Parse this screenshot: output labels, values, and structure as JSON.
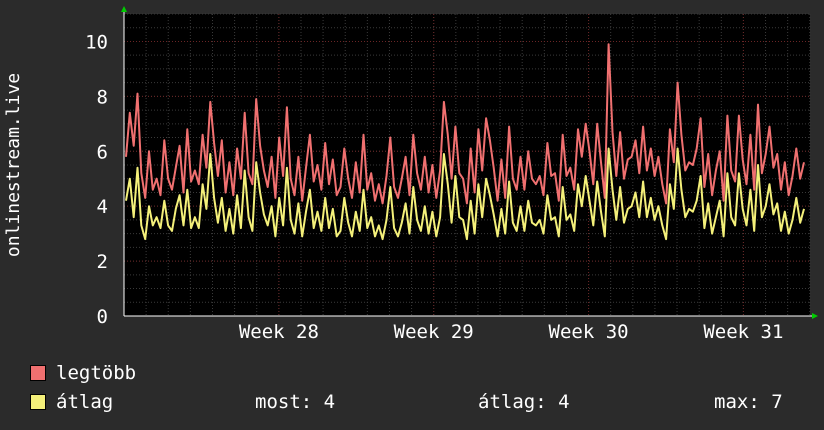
{
  "colors": {
    "background": "#2b2b2b",
    "plot_background": "#000000",
    "grid_minor": "#3a3a3a",
    "grid_major": "#6a2525",
    "axis_arrow": "#00cc00",
    "text": "#ffffff"
  },
  "legend": [
    {
      "label": "legtöbb",
      "color": "#f07070"
    },
    {
      "label": "átlag",
      "color": "#f4f07a"
    }
  ],
  "stats": {
    "most": "most: 4",
    "atlag": "átlag: 4",
    "max": "max: 7"
  },
  "chart_data": {
    "type": "line",
    "ylabel": "onlinestream.live",
    "ylim": [
      0,
      11
    ],
    "yticks": [
      0,
      2,
      4,
      6,
      8,
      10
    ],
    "x_range_weeks": [
      27.0,
      31.43
    ],
    "xticks": [
      {
        "label": "Week 28",
        "week": 28
      },
      {
        "label": "Week 29",
        "week": 29
      },
      {
        "label": "Week 30",
        "week": 30
      },
      {
        "label": "Week 31",
        "week": 31
      }
    ],
    "grid": true,
    "series": [
      {
        "name": "legtöbb",
        "color": "#f07070",
        "values": [
          5.8,
          7.4,
          6.2,
          8.1,
          5.2,
          4.3,
          6.0,
          4.6,
          5.0,
          4.4,
          6.4,
          5.0,
          4.6,
          5.4,
          6.2,
          4.5,
          6.8,
          4.9,
          5.3,
          4.8,
          6.6,
          5.4,
          7.8,
          6.3,
          5.1,
          6.4,
          4.5,
          5.6,
          4.4,
          6.1,
          5.0,
          7.4,
          5.2,
          4.8,
          7.9,
          6.2,
          5.3,
          4.7,
          5.8,
          4.3,
          6.5,
          5.1,
          7.6,
          5.0,
          4.4,
          5.8,
          4.2,
          5.4,
          6.6,
          4.9,
          5.5,
          4.6,
          6.3,
          4.8,
          5.7,
          4.4,
          4.7,
          6.1,
          5.0,
          4.3,
          5.6,
          4.5,
          6.6,
          4.6,
          5.2,
          4.2,
          4.8,
          4.1,
          5.1,
          6.5,
          4.7,
          4.3,
          5.0,
          5.8,
          4.4,
          6.6,
          5.2,
          4.6,
          5.8,
          4.5,
          5.5,
          4.3,
          5.3,
          7.8,
          6.6,
          5.0,
          6.9,
          5.2,
          5.0,
          4.1,
          6.1,
          4.5,
          6.8,
          5.3,
          7.2,
          6.4,
          5.4,
          4.2,
          5.7,
          4.3,
          6.9,
          5.0,
          4.6,
          5.8,
          4.6,
          6.0,
          5.0,
          4.8,
          5.1,
          4.4,
          6.3,
          5.1,
          5.2,
          4.2,
          6.6,
          5.1,
          5.4,
          4.6,
          6.8,
          5.8,
          7.0,
          6.0,
          4.8,
          7.0,
          5.6,
          4.3,
          9.9,
          6.7,
          5.1,
          6.7,
          5.0,
          5.7,
          5.8,
          6.4,
          5.2,
          6.9,
          5.3,
          6.1,
          5.1,
          5.8,
          4.8,
          4.1,
          6.8,
          5.6,
          8.5,
          6.6,
          5.3,
          5.6,
          5.5,
          6.1,
          7.2,
          4.7,
          5.9,
          4.4,
          5.3,
          6.0,
          4.2,
          7.3,
          5.3,
          4.9,
          7.3,
          5.7,
          4.8,
          6.6,
          4.6,
          7.7,
          5.2,
          5.9,
          6.9,
          5.4,
          5.9,
          4.6,
          5.6,
          4.4,
          5.1,
          6.1,
          5.0,
          5.6
        ]
      },
      {
        "name": "átlag",
        "color": "#f4f07a",
        "values": [
          4.2,
          5.0,
          3.6,
          5.4,
          3.3,
          2.8,
          4.0,
          3.3,
          3.6,
          3.2,
          4.2,
          3.3,
          3.1,
          3.9,
          4.4,
          3.3,
          4.6,
          3.2,
          3.6,
          3.2,
          4.8,
          3.9,
          5.9,
          4.3,
          3.4,
          4.3,
          3.1,
          3.9,
          3.0,
          4.4,
          3.2,
          5.3,
          3.6,
          3.1,
          5.6,
          4.5,
          3.7,
          3.3,
          4.0,
          2.9,
          4.3,
          3.3,
          5.4,
          3.5,
          3.0,
          4.1,
          2.9,
          3.8,
          4.6,
          3.2,
          3.8,
          3.1,
          4.3,
          3.2,
          3.9,
          2.9,
          3.1,
          4.3,
          3.4,
          2.9,
          3.8,
          3.1,
          4.6,
          3.2,
          3.6,
          2.9,
          3.3,
          2.8,
          3.5,
          4.7,
          3.2,
          2.9,
          3.4,
          4.1,
          3.0,
          4.7,
          3.5,
          3.1,
          4.0,
          3.0,
          3.8,
          2.9,
          3.6,
          5.9,
          4.8,
          3.4,
          5.1,
          3.6,
          3.5,
          2.8,
          4.2,
          3.0,
          4.8,
          3.6,
          5.0,
          4.4,
          3.7,
          2.9,
          3.9,
          3.0,
          4.9,
          3.4,
          3.1,
          4.0,
          3.1,
          4.2,
          3.4,
          3.3,
          3.5,
          3.0,
          4.4,
          3.5,
          3.6,
          2.9,
          4.7,
          3.5,
          3.7,
          3.1,
          4.8,
          4.0,
          5.1,
          4.2,
          3.3,
          4.9,
          3.8,
          2.9,
          6.1,
          4.6,
          3.5,
          4.7,
          3.4,
          3.9,
          4.0,
          4.5,
          3.6,
          4.9,
          3.6,
          4.3,
          3.5,
          4.0,
          3.3,
          2.8,
          4.8,
          3.9,
          6.1,
          4.6,
          3.6,
          3.9,
          3.8,
          4.2,
          5.1,
          3.2,
          4.1,
          3.0,
          3.6,
          4.2,
          2.9,
          5.2,
          3.6,
          3.3,
          5.2,
          3.9,
          3.3,
          4.6,
          3.1,
          5.5,
          3.6,
          4.0,
          4.8,
          3.7,
          4.1,
          3.1,
          3.8,
          3.0,
          3.5,
          4.3,
          3.4,
          3.9
        ]
      }
    ]
  }
}
